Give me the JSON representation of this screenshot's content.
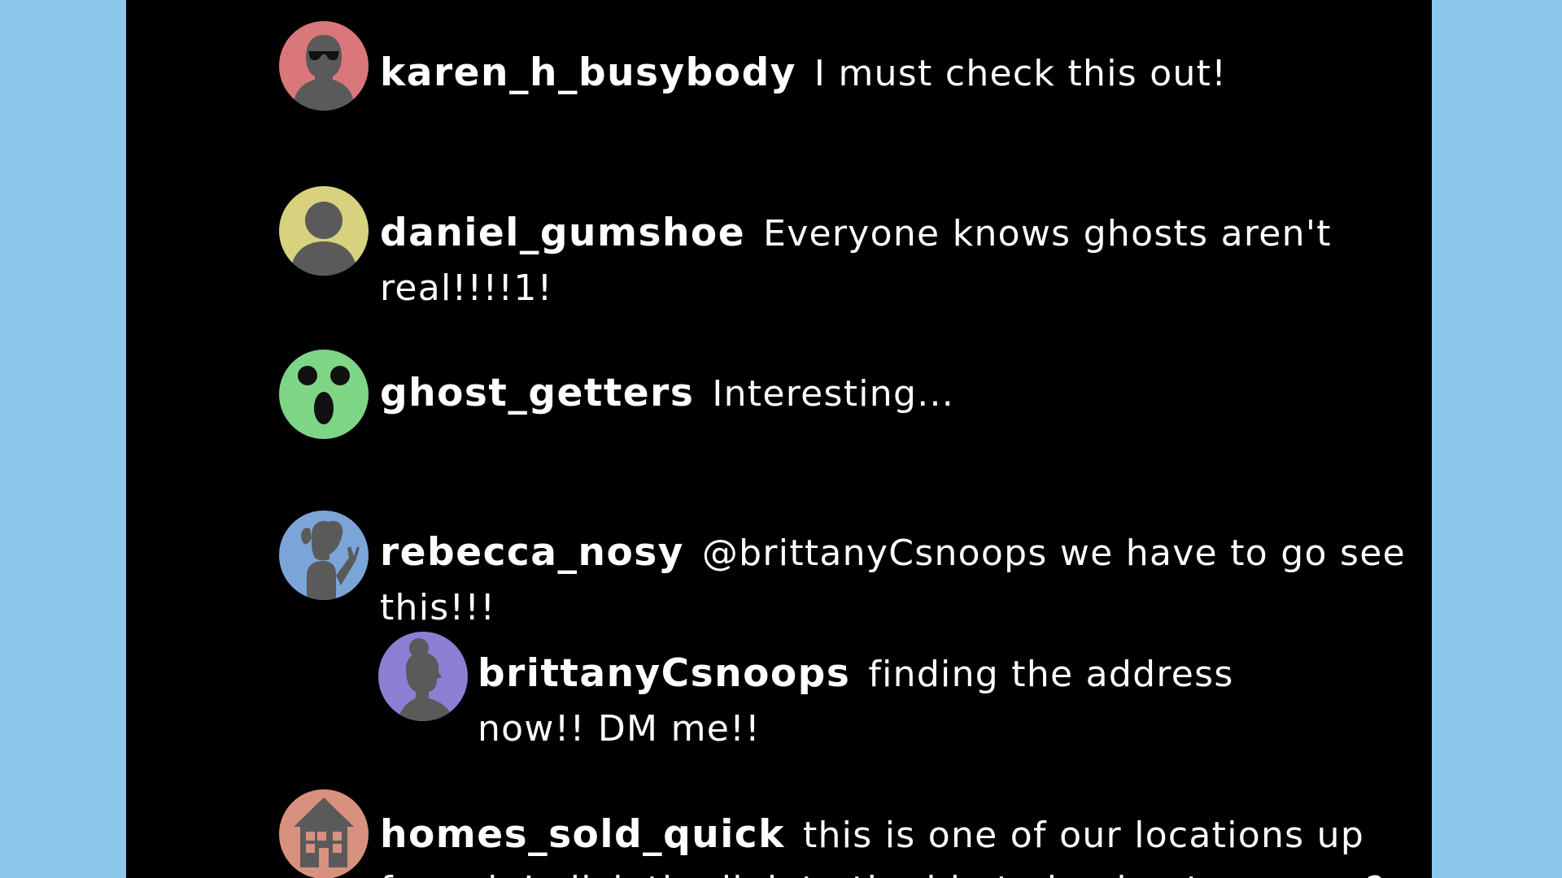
{
  "colors": {
    "page_background": "#8cc8ec",
    "panel_background": "#000000",
    "text": "#ffffff"
  },
  "comments": [
    {
      "username": "karen_h_busybody",
      "message": "I must check this out!",
      "avatar_icon": "woman-sunglasses-silhouette",
      "avatar_color": "#d9777b"
    },
    {
      "username": "daniel_gumshoe",
      "message": "Everyone knows ghosts aren't real!!!!1!",
      "avatar_icon": "person-silhouette",
      "avatar_color": "#d8d27f"
    },
    {
      "username": "ghost_getters",
      "message": "Interesting...",
      "avatar_icon": "shocked-face",
      "avatar_color": "#7ed586"
    },
    {
      "username": "rebecca_nosy",
      "message": "@brittanyCsnoops we have to go see this!!!",
      "avatar_icon": "woman-ponytail-silhouette",
      "avatar_color": "#7ba5d8",
      "replies": [
        {
          "username": "brittanyCsnoops",
          "message": "finding the address now!! DM me!!",
          "avatar_icon": "woman-bun-profile-silhouette",
          "avatar_color": "#8c7fd4"
        }
      ]
    },
    {
      "username": "homes_sold_quick",
      "message": "this is one of our locations up for sale! click the link to the bio to book a tour soon?",
      "avatar_icon": "house-icon",
      "avatar_color": "#d8917f"
    }
  ]
}
